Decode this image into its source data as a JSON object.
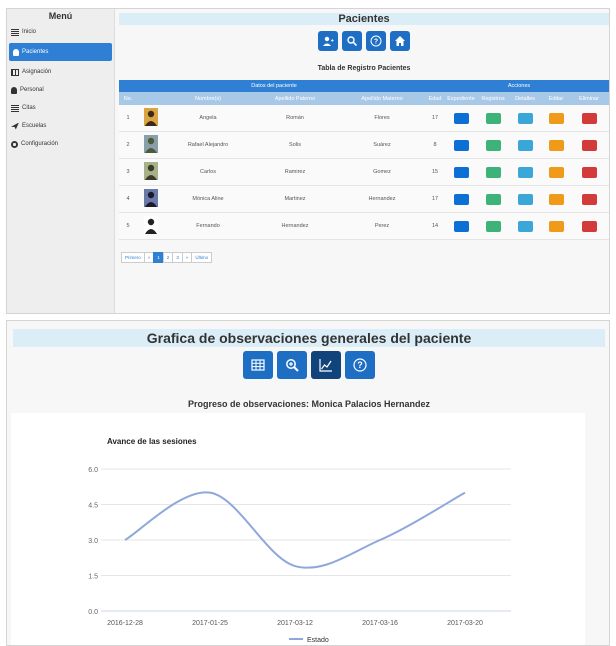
{
  "sidebar": {
    "title": "Menú",
    "items": [
      {
        "label": "Inicio",
        "icon": "list-icon"
      },
      {
        "label": "Pacientes",
        "icon": "user-icon",
        "active": true
      },
      {
        "label": "Asignación",
        "icon": "table-icon"
      },
      {
        "label": "Personal",
        "icon": "user-icon"
      },
      {
        "label": "Citas",
        "icon": "list-icon"
      },
      {
        "label": "Escuelas",
        "icon": "plane-icon"
      },
      {
        "label": "Configuración",
        "icon": "gear-icon"
      }
    ]
  },
  "patients": {
    "header": "Pacientes",
    "toolbar_icons": [
      "add-user-icon",
      "search-icon",
      "help-icon",
      "home-icon"
    ],
    "table_title": "Tabla de Registro Pacientes",
    "group_headers": {
      "data": "Datos del paciente",
      "actions": "Acciones"
    },
    "columns": [
      "No.",
      "Nombre(s)",
      "Apellido Paterno",
      "Apellido Materno",
      "Edad",
      "Expediente",
      "Registros",
      "Detalles",
      "Editar",
      "Eliminar"
    ],
    "rows": [
      {
        "no": "1",
        "name": "Angela",
        "ap": "Román",
        "am": "Flores",
        "age": "17"
      },
      {
        "no": "2",
        "name": "Rafael Alejandro",
        "ap": "Solis",
        "am": "Suárez",
        "age": "8"
      },
      {
        "no": "3",
        "name": "Carlos",
        "ap": "Ramirez",
        "am": "Gomez",
        "age": "15"
      },
      {
        "no": "4",
        "name": "Mónica Aline",
        "ap": "Martinez",
        "am": "Hernandez",
        "age": "17"
      },
      {
        "no": "5",
        "name": "Fernando",
        "ap": "Hernandez",
        "am": "Perez",
        "age": "14"
      }
    ],
    "pagination": {
      "first": "Primero",
      "prev": "«",
      "pages": [
        "1",
        "2",
        "3"
      ],
      "next": "»",
      "last": "Último",
      "current": "1"
    }
  },
  "graph": {
    "header": "Grafica de observaciones generales del paciente",
    "toolbar_icons": [
      "table-icon",
      "zoom-icon",
      "chart-icon",
      "help-icon"
    ],
    "title": "Progreso de observaciones: Monica Palacios Hernandez"
  },
  "colors": {
    "primary": "#2f80d4",
    "dark": "#1e6fc4",
    "line": "#8fa8dc"
  },
  "chart_data": {
    "type": "line",
    "title": "Avance de las sesiones",
    "categories": [
      "2016-12-28",
      "2017-01-25",
      "2017-03-12",
      "2017-03-16",
      "2017-03-20"
    ],
    "series": [
      {
        "name": "Estado",
        "values": [
          3.0,
          5.0,
          1.9,
          3.0,
          5.0
        ]
      }
    ],
    "ylim": [
      0,
      6
    ],
    "yticks": [
      "0.0",
      "1.5",
      "3.0",
      "4.5",
      "6.0"
    ],
    "grid": true,
    "legend": "bottom"
  }
}
